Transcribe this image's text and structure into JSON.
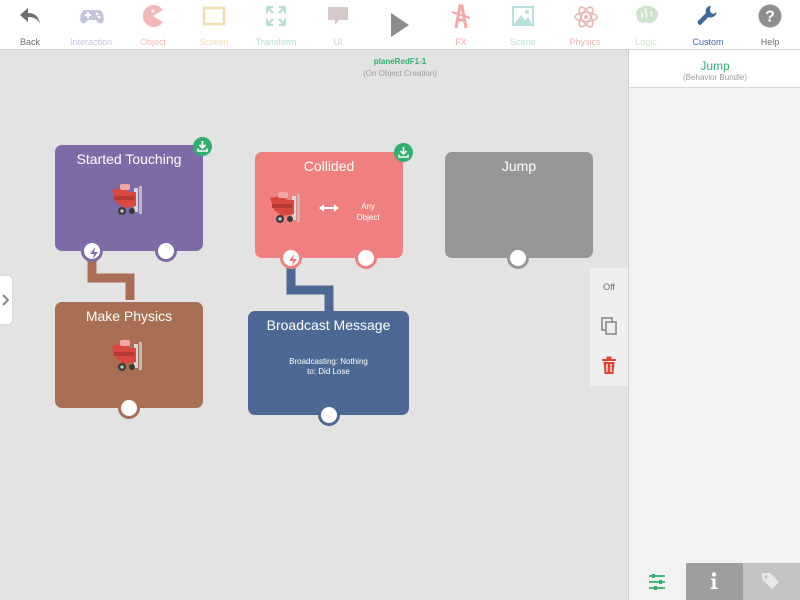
{
  "toolbar": {
    "items": [
      {
        "label": "Back",
        "icon": "back-arrow-icon",
        "color": "#6d6d6d"
      },
      {
        "label": "Interaction",
        "icon": "gamepad-icon",
        "color": "#c3c3dc"
      },
      {
        "label": "Object",
        "icon": "pacman-icon",
        "color": "#f5b8b8"
      },
      {
        "label": "Screen",
        "icon": "screen-icon",
        "color": "#f6dcae"
      },
      {
        "label": "Transform",
        "icon": "transform-icon",
        "color": "#b3ddd8"
      },
      {
        "label": "UI",
        "icon": "speech-bubble-icon",
        "color": "#d7c9c9"
      },
      {
        "label": "",
        "icon": "play-icon",
        "color": "#8c8c8c"
      },
      {
        "label": "FX",
        "icon": "fx-icon",
        "color": "#f5a7a7"
      },
      {
        "label": "Scene",
        "icon": "scene-icon",
        "color": "#b7e2dd"
      },
      {
        "label": "Physics",
        "icon": "atom-icon",
        "color": "#e8b7b2"
      },
      {
        "label": "Logic",
        "icon": "brain-icon",
        "color": "#cde3cc"
      },
      {
        "label": "Custom",
        "icon": "wrench-icon",
        "color": "#3d6a9b"
      },
      {
        "label": "Help",
        "icon": "help-icon",
        "color": "#6d6d6d"
      }
    ]
  },
  "context": {
    "object_name": "planeRedF1-1",
    "event": "(On Object Creation)"
  },
  "blocks": {
    "started_touching": {
      "title": "Started Touching",
      "color": "#7e6aa6"
    },
    "collided": {
      "title": "Collided",
      "color": "#f08080",
      "target": "Any\nObject"
    },
    "jump": {
      "title": "Jump",
      "color": "#979797"
    },
    "make_physics": {
      "title": "Make Physics",
      "color": "#a86f54"
    },
    "broadcast": {
      "title": "Broadcast Message",
      "color": "#4d6894",
      "info_line1": "Broadcasting: Nothing",
      "info_line2": "to: Did Lose"
    }
  },
  "side_tools": {
    "toggle_label": "Off"
  },
  "panel": {
    "title": "Jump",
    "subtitle": "(Behavior Bundle)"
  },
  "colors": {
    "accent_green": "#2faf6d",
    "delete_red": "#e8432e",
    "wire_brown": "#a86f54",
    "wire_blue": "#4d6894"
  }
}
